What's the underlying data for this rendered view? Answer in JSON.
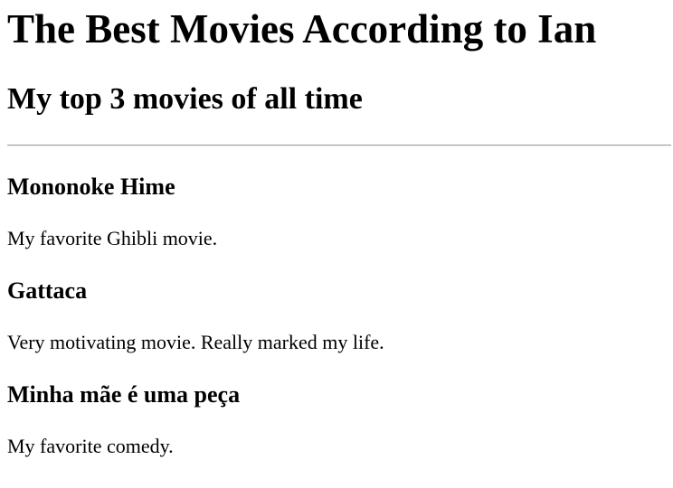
{
  "header": {
    "title": "The Best Movies According to Ian",
    "subtitle": "My top 3 movies of all time"
  },
  "movies": [
    {
      "title": "Mononoke Hime",
      "description": "My favorite Ghibli movie."
    },
    {
      "title": "Gattaca",
      "description": "Very motivating movie. Really marked my life."
    },
    {
      "title": "Minha mãe é uma peça",
      "description": "My favorite comedy."
    }
  ]
}
